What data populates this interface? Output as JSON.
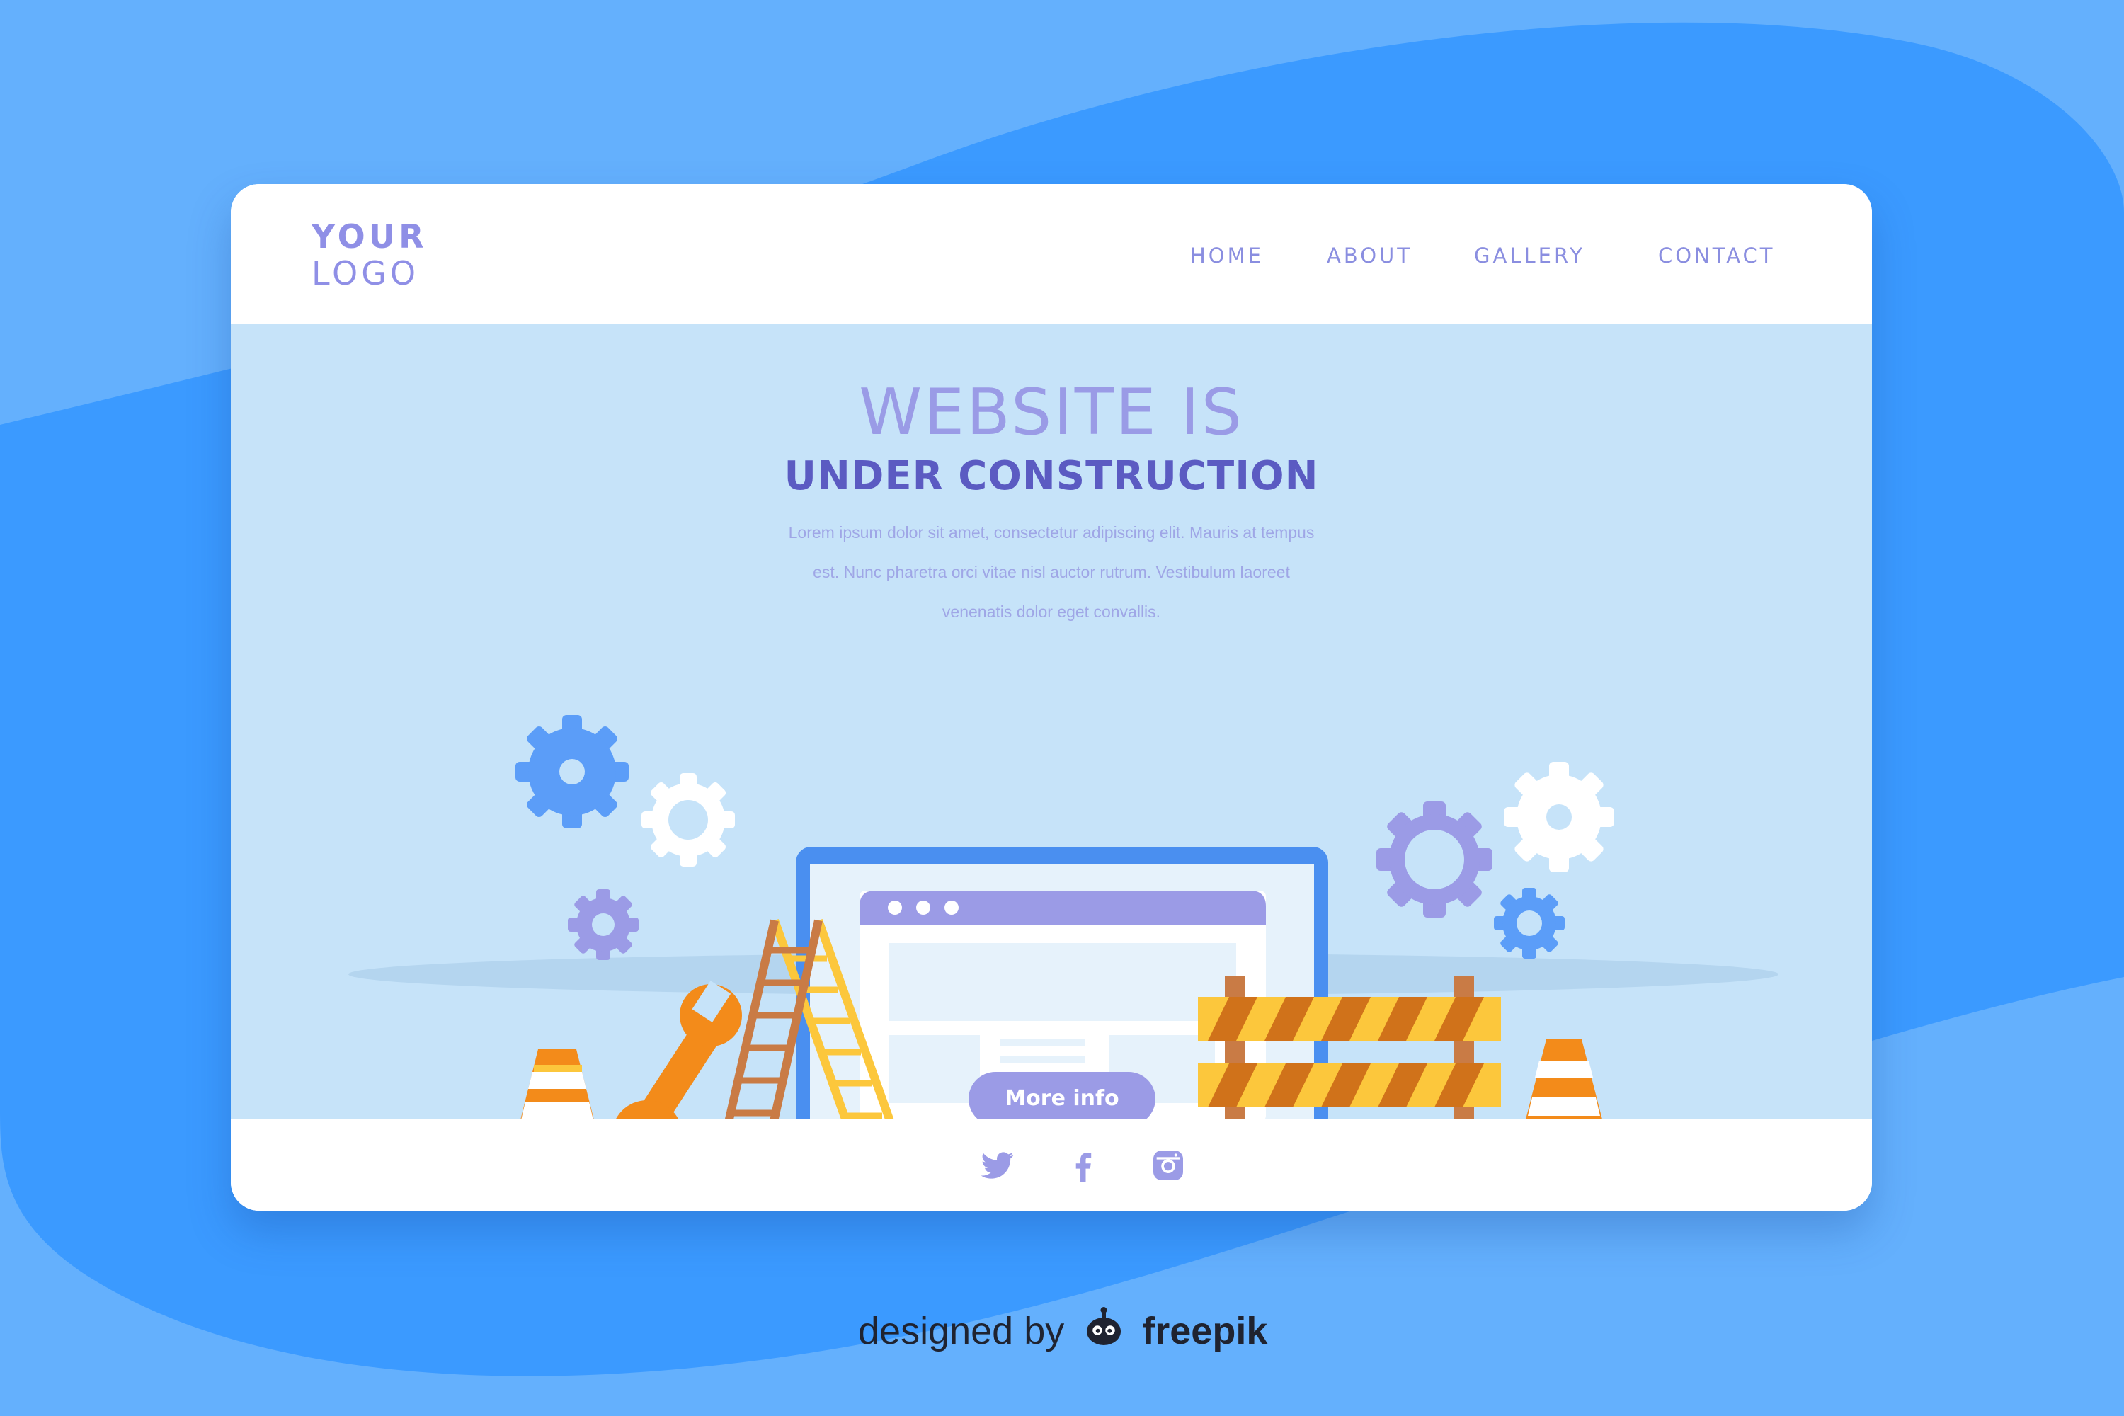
{
  "logo": {
    "line1": "YOUR",
    "line2": "LOGO"
  },
  "nav": {
    "items": [
      {
        "label": "HOME"
      },
      {
        "label": "ABOUT"
      },
      {
        "label": "GALLERY"
      },
      {
        "label": "CONTACT"
      }
    ]
  },
  "hero": {
    "headline_1": "WEBSITE IS",
    "headline_2": "UNDER CONSTRUCTION",
    "body_lines": [
      "Lorem ipsum dolor sit amet, consectetur adipiscing elit. Mauris at tempus",
      "est. Nunc pharetra orci vitae nisl auctor rutrum. Vestibulum laoreet",
      "venenatis dolor eget convallis."
    ],
    "cta_label": "More info"
  },
  "footer": {
    "social_icons": [
      "twitter-icon",
      "facebook-icon",
      "instagram-icon"
    ]
  },
  "credit": {
    "prefix": "designed by",
    "brand": "freepik"
  },
  "colors": {
    "background": "#64b0fd",
    "background_dark": "#3b9aff",
    "hero_bg": "#c6e3f9",
    "accent": "#9b9be6",
    "headline_dark": "#5b5bc2",
    "orange": "#f38b1a",
    "yellow": "#fcc73c",
    "blue": "#5b9df8"
  }
}
